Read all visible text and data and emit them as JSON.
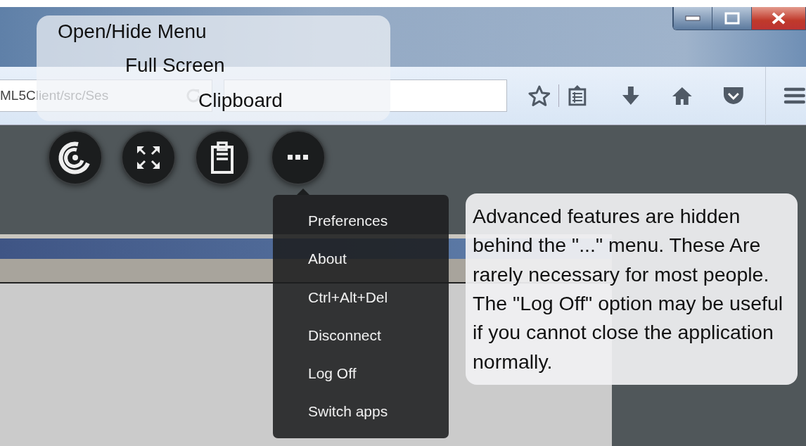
{
  "browser_toolbar": {
    "address": "ML5Client/src/Ses"
  },
  "callouts": [
    {
      "kind": "labels",
      "lines": [
        "Open/Hide Menu",
        "Full Screen",
        "Clipboard"
      ]
    },
    {
      "kind": "note",
      "paragraphs": [
        "Advanced features are hidden behind the \"...\" menu.  These Are rarely necessary for most people.",
        "The \"Log Off\" option may be useful if you cannot close the application normally."
      ]
    }
  ],
  "menu": {
    "items": [
      "Preferences",
      "About",
      "Ctrl+Alt+Del",
      "Disconnect",
      "Log Off",
      "Switch apps"
    ]
  }
}
